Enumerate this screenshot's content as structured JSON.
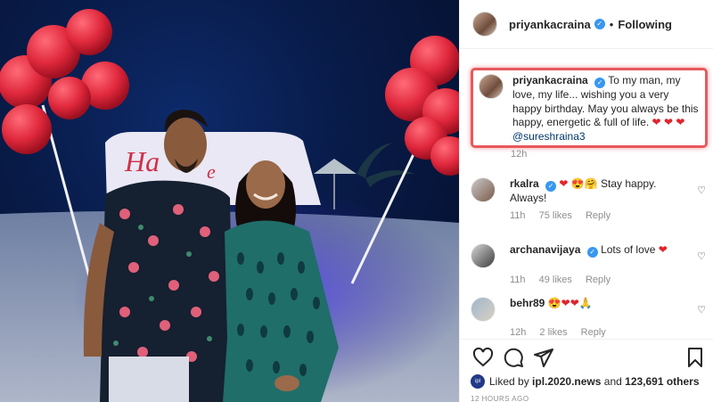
{
  "post": {
    "author": "priyankacraina",
    "follow_status": "Following",
    "separator": "•",
    "caption_text": "To my man, my love, my life... wishing you a very happy birthday. May you always be this happy, energetic & full of life.",
    "caption_mention": "@sureshraina3",
    "caption_time": "12h",
    "sign_text": "Ha",
    "sign_text_2": "e"
  },
  "comments": [
    {
      "user": "rkalra",
      "verified": true,
      "text": "Stay happy. Always!",
      "emojis": "❤ 😍🤗",
      "time": "11h",
      "likes": "75 likes",
      "reply": "Reply"
    },
    {
      "user": "archanavijaya",
      "verified": true,
      "text": "Lots of love",
      "emojis": "❤",
      "time": "11h",
      "likes": "49 likes",
      "reply": "Reply"
    },
    {
      "user": "behr89",
      "verified": false,
      "text": "",
      "emojis": "😍❤❤🙏",
      "time": "12h",
      "likes": "2 likes",
      "reply": "Reply"
    }
  ],
  "footer": {
    "liked_by_prefix": "Liked by",
    "liked_by_user": "ipl.2020.news",
    "liked_by_and": "and",
    "liked_by_count": "123,691 others",
    "likes_avatar_text": "ipl",
    "post_time": "12 HOURS AGO"
  },
  "colors": {
    "heart": "#e0242c",
    "verified": "#3897f0",
    "highlight": "#e8595c",
    "balloon": "#e0283c"
  },
  "icons": [
    "heart-icon",
    "comment-icon",
    "share-icon",
    "bookmark-icon",
    "verified-icon"
  ]
}
